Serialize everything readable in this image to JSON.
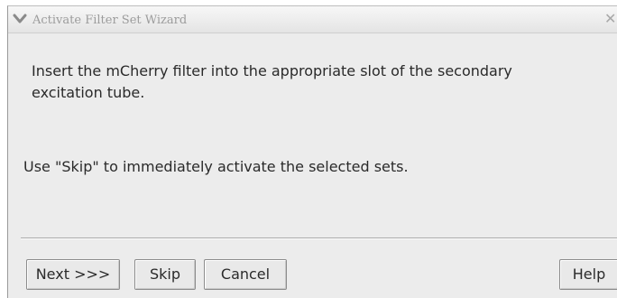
{
  "window": {
    "title": "Activate Filter Set Wizard",
    "close_glyph": "✕"
  },
  "content": {
    "instruction_line1": "Insert the mCherry filter into the appropriate slot of the secondary",
    "instruction_line2": "excitation tube.",
    "skip_hint": "Use \"Skip\" to immediately activate the selected sets."
  },
  "buttons": {
    "next_label": "Next >>>",
    "skip_label": "Skip",
    "cancel_label": "Cancel",
    "help_label": "Help"
  },
  "icons": {
    "menu": "chevron-down-icon",
    "close": "close-icon"
  },
  "colors": {
    "window_bg": "#ececec",
    "title_text": "#9c9c9c",
    "body_text": "#2a2a2a"
  }
}
